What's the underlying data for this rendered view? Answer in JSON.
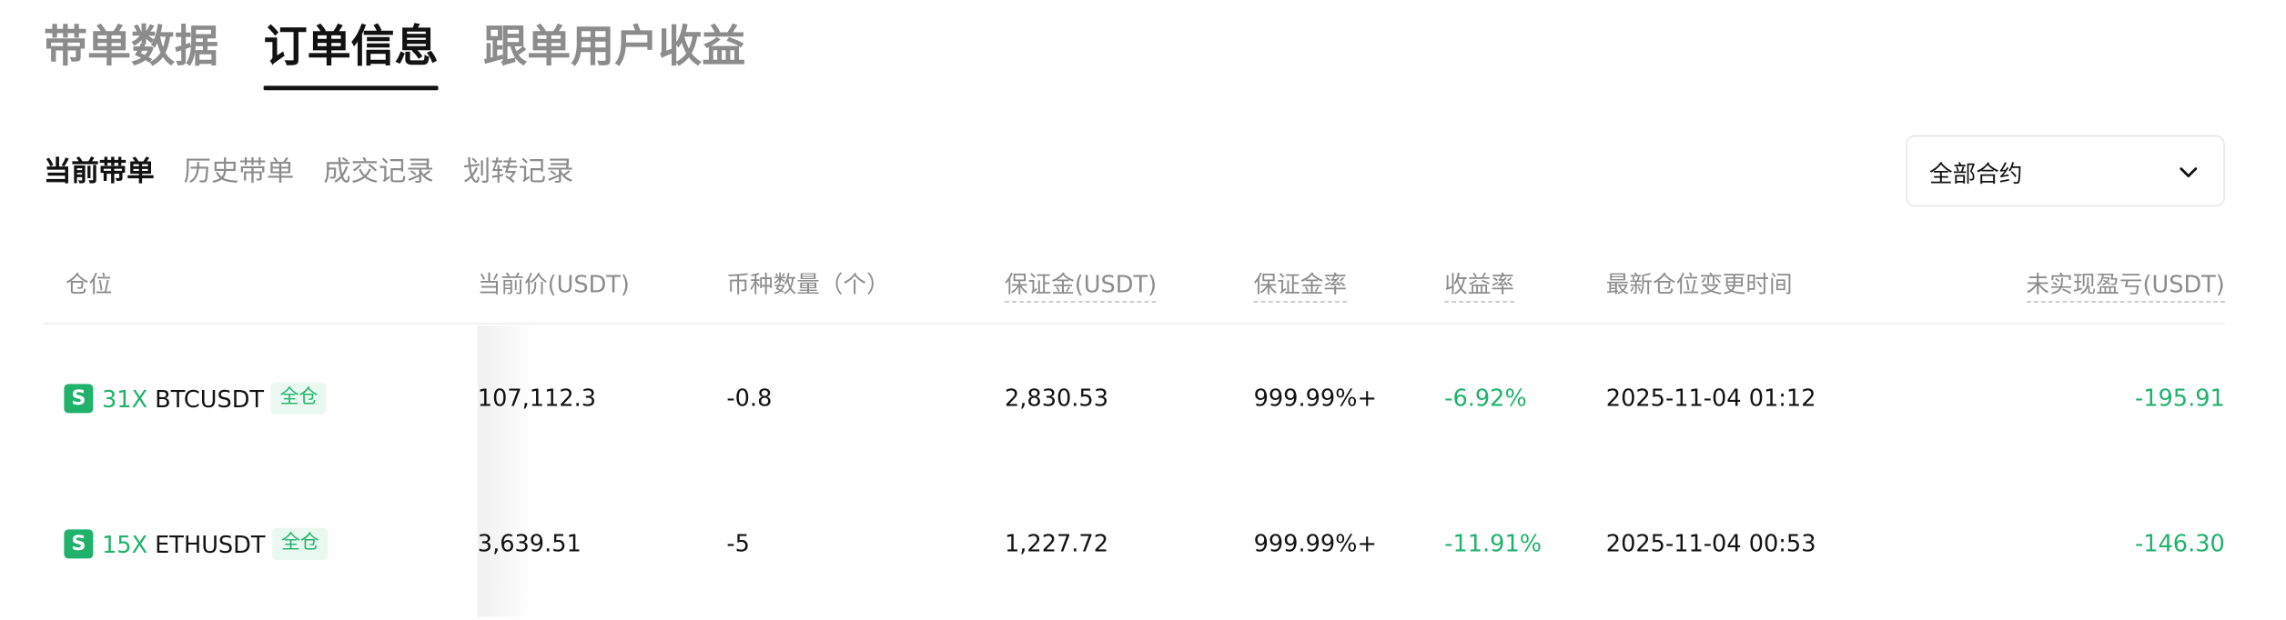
{
  "main_tabs": [
    {
      "label": "带单数据"
    },
    {
      "label": "订单信息"
    },
    {
      "label": "跟单用户收益"
    }
  ],
  "sub_tabs": [
    {
      "label": "当前带单"
    },
    {
      "label": "历史带单"
    },
    {
      "label": "成交记录"
    },
    {
      "label": "划转记录"
    }
  ],
  "contract_filter": {
    "selected": "全部合约"
  },
  "table": {
    "headers": {
      "position": "仓位",
      "current_price": "当前价(USDT)",
      "quantity": "币种数量（个）",
      "margin": "保证金(USDT)",
      "margin_rate": "保证金率",
      "return_rate": "收益率",
      "last_change_time": "最新仓位变更时间",
      "unrealized_pnl": "未实现盈亏(USDT)"
    },
    "rows": [
      {
        "side_badge": "S",
        "leverage": "31X",
        "symbol": "BTCUSDT",
        "margin_mode": "全仓",
        "current_price": "107,112.3",
        "quantity": "-0.8",
        "margin": "2,830.53",
        "margin_rate": "999.99%+",
        "return_rate": "-6.92%",
        "last_change_time": "2025-11-04 01:12",
        "unrealized_pnl": "-195.91"
      },
      {
        "side_badge": "S",
        "leverage": "15X",
        "symbol": "ETHUSDT",
        "margin_mode": "全仓",
        "current_price": "3,639.51",
        "quantity": "-5",
        "margin": "1,227.72",
        "margin_rate": "999.99%+",
        "return_rate": "-11.91%",
        "last_change_time": "2025-11-04 00:53",
        "unrealized_pnl": "-146.30"
      }
    ]
  },
  "colors": {
    "profit_loss_green": "#20b26c",
    "text_primary": "#121212",
    "text_secondary": "#8c8c8c"
  },
  "icons": {
    "dropdown": "chevron-down-icon"
  }
}
